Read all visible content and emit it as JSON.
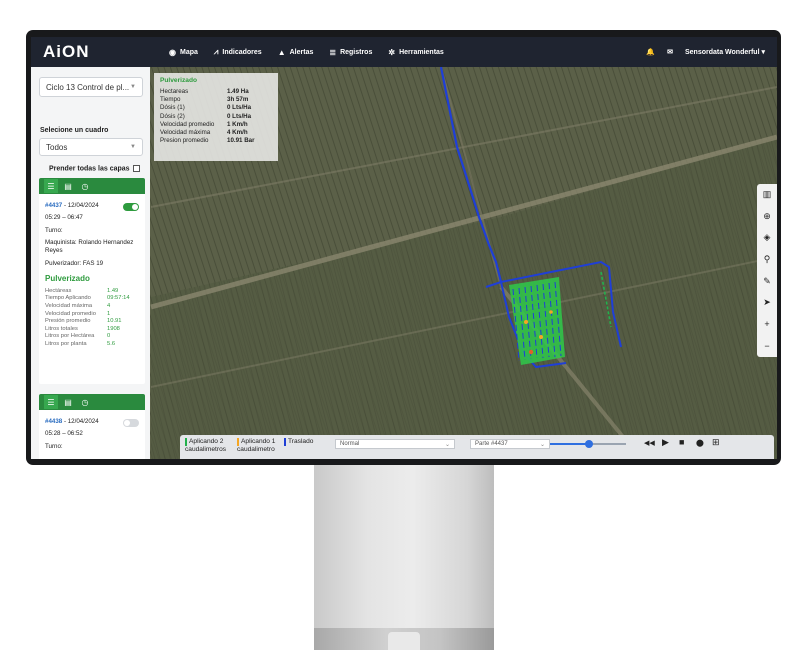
{
  "app": {
    "logo": "AiON"
  },
  "nav": [
    {
      "icon": "gauge-icon",
      "glyph": "◉",
      "label": "Mapa"
    },
    {
      "icon": "chart-icon",
      "glyph": "⩘",
      "label": "Indicadores"
    },
    {
      "icon": "warning-icon",
      "glyph": "▲",
      "label": "Alertas"
    },
    {
      "icon": "database-icon",
      "glyph": "≣",
      "label": "Registros"
    },
    {
      "icon": "tools-icon",
      "glyph": "✲",
      "label": "Herramientas"
    }
  ],
  "user": {
    "name": "Sensordata Wonderful ▾",
    "bell_glyph": "🔔",
    "mail_glyph": "✉"
  },
  "sidebar": {
    "cycle_select": "Ciclo 13 Control de pl...",
    "select_label": "Selecione un cuadro",
    "cuadro_select": "Todos",
    "layers_label": "Prender todas las capas",
    "cards": [
      {
        "id": "#4437",
        "date": " - 12/04/2024",
        "time": "05:29 – 06:47",
        "turno": "Turno:",
        "maquinista": "Maquinista: Rolando Hernandez Reyes",
        "pulverizador": "Pulverizador: FAS 19",
        "status": "Pulverizado",
        "toggle_on": true,
        "stats": [
          {
            "k": "Hectáreas",
            "v": "1.49"
          },
          {
            "k": "Tiempo Aplicando",
            "v": "09:57:14"
          },
          {
            "k": "Velocidad máxima",
            "v": "4"
          },
          {
            "k": "Velocidad promedio",
            "v": "1"
          },
          {
            "k": "Presión promedio",
            "v": "10.91"
          },
          {
            "k": "Litros totales",
            "v": "1908"
          },
          {
            "k": "Litros por Hectárea",
            "v": "0"
          },
          {
            "k": "Litros por planta",
            "v": "5.6"
          }
        ]
      },
      {
        "id": "#4438",
        "date": " - 12/04/2024",
        "time": "05:28 – 06:52",
        "turno": "Turno:",
        "toggle_on": false
      }
    ]
  },
  "info_box": {
    "title": "Pulverizado",
    "rows": [
      {
        "k": "Hectareas",
        "v": "1.49 Ha"
      },
      {
        "k": "Tiempo",
        "v": "3h 57m"
      },
      {
        "k": "Dósis (1)",
        "v": "0 Lts/Ha"
      },
      {
        "k": "Dósis (2)",
        "v": "0 Lts/Ha"
      },
      {
        "k": "Velocidad promedio",
        "v": "1 Km/h"
      },
      {
        "k": "Velocidad máxima",
        "v": "4 Km/h"
      },
      {
        "k": "Presion promedio",
        "v": "10.91 Bar"
      }
    ]
  },
  "map_tools": [
    {
      "name": "map-layers-icon",
      "glyph": "▥"
    },
    {
      "name": "globe-icon",
      "glyph": "⊕"
    },
    {
      "name": "compass-icon",
      "glyph": "◈"
    },
    {
      "name": "pin-icon",
      "glyph": "⚲"
    },
    {
      "name": "ruler-icon",
      "glyph": "✎"
    },
    {
      "name": "navigate-icon",
      "glyph": "➤"
    },
    {
      "name": "zoom-in-icon",
      "glyph": "+"
    },
    {
      "name": "zoom-out-icon",
      "glyph": "−"
    }
  ],
  "bottombar": {
    "legend": [
      {
        "label": "Aplicando 2 caudalimetros",
        "color": "#22b14c"
      },
      {
        "label": "Aplicando 1 caudalimetro",
        "color": "#f5a623"
      },
      {
        "label": "Traslado",
        "color": "#1f3fd6"
      }
    ],
    "mode_select": "Normal",
    "part_select": "Parte #4437",
    "playback_progress": 0.47,
    "controls": [
      {
        "name": "rewind-icon",
        "glyph": "◀◀"
      },
      {
        "name": "play-icon",
        "glyph": "▶"
      },
      {
        "name": "stop-icon",
        "glyph": "■"
      },
      {
        "name": "marker-icon",
        "glyph": "⬤"
      },
      {
        "name": "table-icon",
        "glyph": "⊞"
      }
    ]
  }
}
